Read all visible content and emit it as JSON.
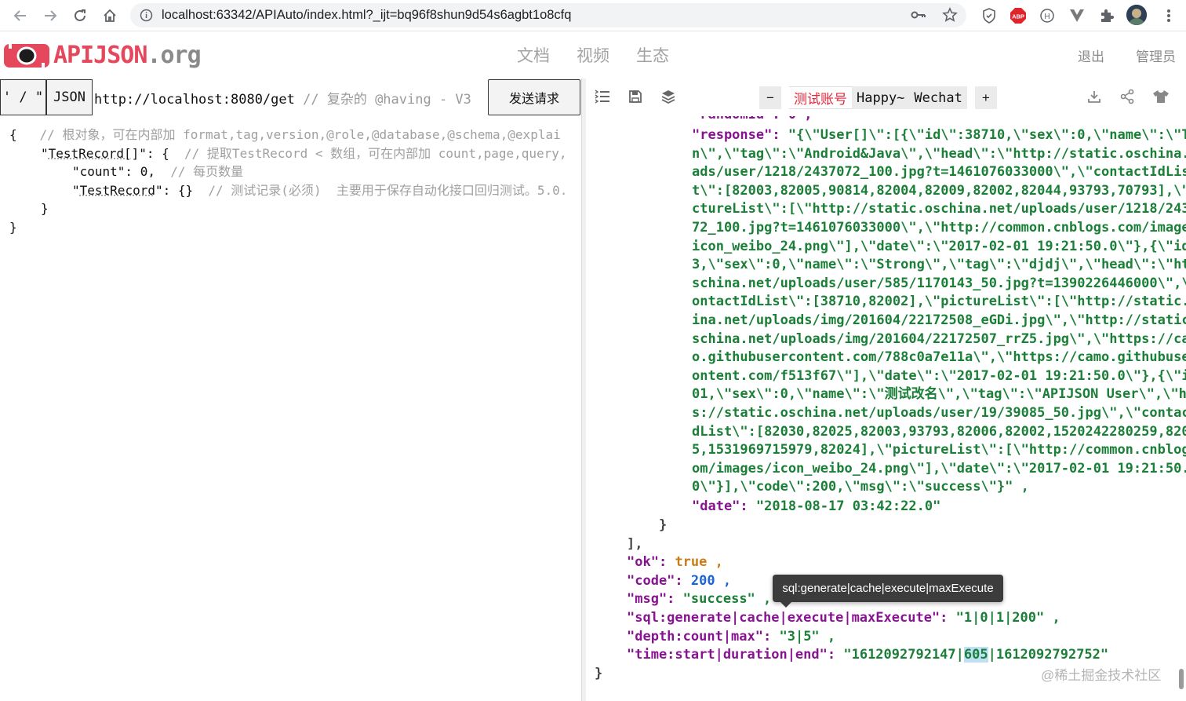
{
  "browser": {
    "url": "localhost:63342/APIAuto/index.html?_ijt=bq96f8shun9d54s6agbt1o8cfq"
  },
  "header": {
    "logo": "APIJSON",
    "logo_suffix": ".org",
    "nav": [
      "文档",
      "视频",
      "生态"
    ],
    "right": [
      "退出",
      "管理员"
    ],
    "accent": "#e5485d"
  },
  "request": {
    "quote_toggle": "' / \"",
    "format_button": "JSON",
    "url": "http://localhost:8080/get",
    "url_comment": "// 复杂的 @having - V3",
    "send_label": "发送请求"
  },
  "editor": {
    "lines": [
      {
        "code": "{",
        "comment": "// 根对象，可在内部加 format,tag,version,@role,@database,@schema,@explai"
      },
      {
        "code": "\"TestRecord[]\": {",
        "comment": "// 提取TestRecord < 数组，可在内部加 count,page,query,"
      },
      {
        "code": "\"count\": 0,",
        "comment": "// 每页数量"
      },
      {
        "code": "\"TestRecord\": {}",
        "comment": "// 测试记录(必须)  主要用于保存自动化接口回归测试。5.0."
      },
      {
        "code": "}",
        "comment": ""
      },
      {
        "code": "}",
        "comment": ""
      }
    ]
  },
  "accounts": {
    "minus": "−",
    "plus": "+",
    "items": [
      {
        "label": "测试账号",
        "selected": true
      },
      {
        "label": "Happy~",
        "selected": false
      },
      {
        "label": "Wechat",
        "selected": false
      }
    ]
  },
  "response": {
    "cut_line": "\"randomId\": 0 ,",
    "response_key": "\"response\":",
    "response_lines": [
      "\"{\\\"User[]\\\":[{\\\"id\\\":38710,\\\"sex\\\":0,\\\"name\\\":\\\"TommyLemo",
      "n\\\",\\\"tag\\\":\\\"Android&Java\\\",\\\"head\\\":\\\"http://static.oschina.net/uplo",
      "ads/user/1218/2437072_100.jpg?t=1461076033000\\\",\\\"contactIdLis",
      "t\\\":[82003,82005,90814,82004,82009,82002,82044,93793,70793],\\\"pi",
      "ctureList\\\":[\\\"http://static.oschina.net/uploads/user/1218/24370",
      "72_100.jpg?t=1461076033000\\\",\\\"http://common.cnblogs.com/images/",
      "icon_weibo_24.png\\\"],\\\"date\\\":\\\"2017-02-01 19:21:50.0\\\"},{\\\"id\\\":7079",
      "3,\\\"sex\\\":0,\\\"name\\\":\\\"Strong\\\",\\\"tag\\\":\\\"djdj\\\",\\\"head\\\":\\\"http://static.o",
      "schina.net/uploads/user/585/1170143_50.jpg?t=1390226446000\\\",\\\"c",
      "ontactIdList\\\":[38710,82002],\\\"pictureList\\\":[\\\"http://static.osch",
      "ina.net/uploads/img/201604/22172508_eGDi.jpg\\\",\\\"http://static.o",
      "schina.net/uploads/img/201604/22172507_rrZ5.jpg\\\",\\\"https://cam",
      "o.githubusercontent.com/788c0a7e11a\\\",\\\"https://camo.githubuserc",
      "ontent.com/f513f67\\\"],\\\"date\\\":\\\"2017-02-01 19:21:50.0\\\"},{\\\"id\\\":820",
      "01,\\\"sex\\\":0,\\\"name\\\":\\\"测试改名\\\",\\\"tag\\\":\\\"APIJSON User\\\",\\\"head\\\":\\\"http",
      "s://static.oschina.net/uploads/user/19/39085_50.jpg\\\",\\\"contactI",
      "dList\\\":[82030,82025,82003,93793,82006,82002,1520242280259,8200",
      "5,1531969715979,82024],\\\"pictureList\\\":[\\\"http://common.cnblogs.c",
      "om/images/icon_weibo_24.png\\\"],\\\"date\\\":\\\"2017-02-01 19:21:50.",
      "0\\\"}],\\\"code\\\":200,\\\"msg\\\":\\\"success\\\"}\" ,"
    ],
    "date_key": "\"date\":",
    "date_val": "\"2018-08-17 03:42:22.0\"",
    "close_brace": "}",
    "close_bracket": "],",
    "ok_key": "\"ok\":",
    "ok_val": "true ,",
    "code_key": "\"code\":",
    "code_val": "200 ,",
    "msg_key": "\"msg\":",
    "msg_val": "\"success\" ,",
    "sql_key": "\"sql:generate|cache|execute|maxExecute\":",
    "sql_val": "\"1|0|1|200\" ,",
    "depth_key": "\"depth:count|max\":",
    "depth_val": "\"3|5\" ,",
    "time_key": "\"time:start|duration|end\":",
    "time_val_a": "\"1612092792147|",
    "time_val_hl": "605",
    "time_val_b": "|1612092792752\"",
    "root_close": "}"
  },
  "tooltip": "sql:generate|cache|execute|maxExecute",
  "watermark": "@稀土掘金技术社区"
}
